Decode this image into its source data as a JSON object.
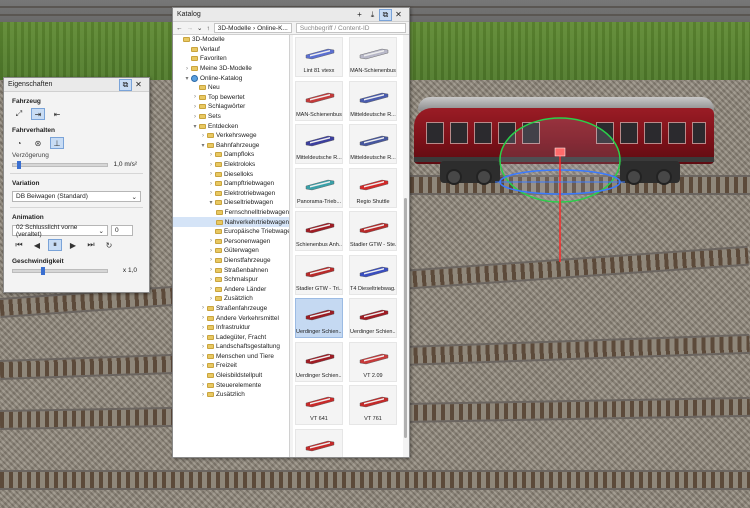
{
  "properties_panel": {
    "title": "Eigenschaften",
    "sections": {
      "vehicle": "Fahrzeug",
      "driving": "Fahrverhalten",
      "deceleration_label": "Verzögerung",
      "deceleration_value": "1,0 m/s²",
      "deceleration_level": 0.05,
      "variation": "Variation",
      "variation_value": "DB Beiwagen (Standard)",
      "animation": "Animation",
      "animation_value": "02 Schlusslicht vorne (veraltet)",
      "animation_count": "0",
      "speed_label": "Geschwindigkeit",
      "speed_value": "x 1,0",
      "speed_level": 0.3
    }
  },
  "catalog": {
    "title": "Katalog",
    "breadcrumb": [
      "3D-Modelle",
      "Online-K..."
    ],
    "search_placeholder": "Suchbegriff / Content-ID",
    "tree": [
      {
        "label": "3D-Modelle",
        "level": 0,
        "exp": "",
        "icon": "folder"
      },
      {
        "label": "Verlauf",
        "level": 1,
        "exp": "",
        "icon": "folder"
      },
      {
        "label": "Favoriten",
        "level": 1,
        "exp": "",
        "icon": "folder"
      },
      {
        "label": "Meine 3D-Modelle",
        "level": 1,
        "exp": ">",
        "icon": "folder"
      },
      {
        "label": "Online-Katalog",
        "level": 1,
        "exp": "v",
        "icon": "globe"
      },
      {
        "label": "Neu",
        "level": 2,
        "exp": "",
        "icon": "folder"
      },
      {
        "label": "Top bewertet",
        "level": 2,
        "exp": ">",
        "icon": "folder"
      },
      {
        "label": "Schlagwörter",
        "level": 2,
        "exp": ">",
        "icon": "folder"
      },
      {
        "label": "Sets",
        "level": 2,
        "exp": ">",
        "icon": "folder"
      },
      {
        "label": "Entdecken",
        "level": 2,
        "exp": "v",
        "icon": "folder"
      },
      {
        "label": "Verkehrswege",
        "level": 3,
        "exp": ">",
        "icon": "folder"
      },
      {
        "label": "Bahnfahrzeuge",
        "level": 3,
        "exp": "v",
        "icon": "folder"
      },
      {
        "label": "Dampfloks",
        "level": 4,
        "exp": ">",
        "icon": "folder"
      },
      {
        "label": "Elektroloks",
        "level": 4,
        "exp": ">",
        "icon": "folder"
      },
      {
        "label": "Dieselloks",
        "level": 4,
        "exp": ">",
        "icon": "folder"
      },
      {
        "label": "Dampftriebwagen",
        "level": 4,
        "exp": ">",
        "icon": "folder"
      },
      {
        "label": "Elektrotriebwagen",
        "level": 4,
        "exp": ">",
        "icon": "folder"
      },
      {
        "label": "Dieseltriebwagen",
        "level": 4,
        "exp": "v",
        "icon": "folder"
      },
      {
        "label": "Fernschnelltriebwagen",
        "level": 5,
        "exp": "",
        "icon": "folder"
      },
      {
        "label": "Nahverkehrtriebwagen",
        "level": 5,
        "exp": "",
        "icon": "folder",
        "selected": true
      },
      {
        "label": "Europäische Triebwagen",
        "level": 5,
        "exp": "",
        "icon": "folder"
      },
      {
        "label": "Personenwagen",
        "level": 4,
        "exp": ">",
        "icon": "folder"
      },
      {
        "label": "Güterwagen",
        "level": 4,
        "exp": ">",
        "icon": "folder"
      },
      {
        "label": "Dienstfahrzeuge",
        "level": 4,
        "exp": ">",
        "icon": "folder"
      },
      {
        "label": "Straßenbahnen",
        "level": 4,
        "exp": ">",
        "icon": "folder"
      },
      {
        "label": "Schmalspur",
        "level": 4,
        "exp": ">",
        "icon": "folder"
      },
      {
        "label": "Andere Länder",
        "level": 4,
        "exp": ">",
        "icon": "folder"
      },
      {
        "label": "Zusätzlich",
        "level": 4,
        "exp": ">",
        "icon": "folder"
      },
      {
        "label": "Straßenfahrzeuge",
        "level": 3,
        "exp": ">",
        "icon": "folder"
      },
      {
        "label": "Andere Verkehrsmittel",
        "level": 3,
        "exp": ">",
        "icon": "folder"
      },
      {
        "label": "Infrastruktur",
        "level": 3,
        "exp": ">",
        "icon": "folder"
      },
      {
        "label": "Ladegüter, Fracht",
        "level": 3,
        "exp": ">",
        "icon": "folder"
      },
      {
        "label": "Landschaftsgestaltung",
        "level": 3,
        "exp": ">",
        "icon": "folder"
      },
      {
        "label": "Menschen und Tiere",
        "level": 3,
        "exp": ">",
        "icon": "folder"
      },
      {
        "label": "Freizeit",
        "level": 3,
        "exp": ">",
        "icon": "folder"
      },
      {
        "label": "Gleisbildstellpult",
        "level": 3,
        "exp": "",
        "icon": "folder"
      },
      {
        "label": "Steuerelemente",
        "level": 3,
        "exp": ">",
        "icon": "folder"
      },
      {
        "label": "Zusätzlich",
        "level": 3,
        "exp": ">",
        "icon": "folder"
      }
    ],
    "items": [
      {
        "label": "Lint 81 vtexx",
        "color": "#5b6fd0"
      },
      {
        "label": "MAN-Schienenbus",
        "color": "#b8b8c8"
      },
      {
        "label": "MAN-Schienenbus",
        "color": "#c43a3a"
      },
      {
        "label": "Mitteldeutsche R...",
        "color": "#4a5cae"
      },
      {
        "label": "Mitteldeutsche R...",
        "color": "#3c3f9e"
      },
      {
        "label": "Mitteldeutsche R...",
        "color": "#46569e"
      },
      {
        "label": "Panorama-Trieb...",
        "color": "#3aa0a8"
      },
      {
        "label": "Regio Shuttle",
        "color": "#d22a2a"
      },
      {
        "label": "Schienenbus Anh...",
        "color": "#a01c24"
      },
      {
        "label": "Stadler GTW - Ste...",
        "color": "#b82a2a"
      },
      {
        "label": "Stadler GTW - Tri...",
        "color": "#b82a2a"
      },
      {
        "label": "T4 Dieseltriebwag...",
        "color": "#3a4ec0"
      },
      {
        "label": "Uerdinger Schien...",
        "color": "#9a1c25",
        "selected": true
      },
      {
        "label": "Uerdinger Schien...",
        "color": "#a01c24"
      },
      {
        "label": "Uerdinger Schien...",
        "color": "#a01c24"
      },
      {
        "label": "VT 2.09",
        "color": "#c83a3a"
      },
      {
        "label": "VT 641",
        "color": "#c82a2a"
      },
      {
        "label": "VT 761",
        "color": "#c42a2a"
      },
      {
        "label": "",
        "color": "#c42a2a"
      }
    ]
  }
}
